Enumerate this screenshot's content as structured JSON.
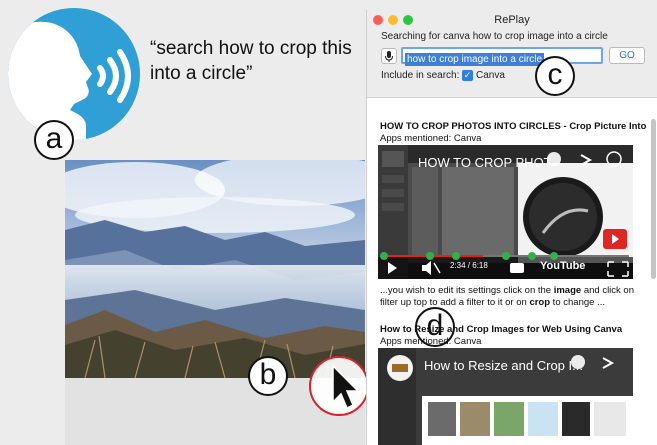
{
  "annotations": {
    "speech_quote": "“search how to crop this into a circle”",
    "label_a": "a",
    "label_b": "b",
    "label_c": "c",
    "label_d": "d"
  },
  "window": {
    "title": "RePlay",
    "search_status": "Searching for canva how to crop image into a circle",
    "query_value": "how to crop image into a circle",
    "go_label": "GO",
    "include_label": "Include in search:",
    "include_app": "Canva",
    "include_checked": true
  },
  "results": [
    {
      "title": "HOW TO CROP PHOTOS INTO CIRCLES - Crop Picture Into",
      "apps": "Apps mentioned: Canva",
      "video_title": "HOW TO CROP PHOT",
      "time": "2:34 / 6:18",
      "platform": "YouTube",
      "progress": 0.41,
      "snippet_parts": [
        "...you wish to edit its settings click on the ",
        "image",
        " and click on filter up top to add a filter to it or on ",
        "crop",
        " to change ..."
      ]
    },
    {
      "title": "How to Resize and Crop Images for Web Using Canva",
      "apps": "Apps mentioned: Canva",
      "video_title": "How to Resize and Crop I..."
    }
  ],
  "colors": {
    "accent": "#2f9fd6",
    "selection": "#3d7fd9",
    "highlight_ring": "#d8232a",
    "progress": "#e62117",
    "segment_marker": "#2db34a"
  },
  "icons": [
    "speaking-head-icon",
    "sound-waves-icon",
    "microphone-icon",
    "mouse-cursor-icon",
    "clock-icon",
    "share-icon",
    "info-icon",
    "play-icon",
    "mute-icon",
    "captions-icon",
    "fullscreen-icon",
    "subscribe-icon"
  ]
}
